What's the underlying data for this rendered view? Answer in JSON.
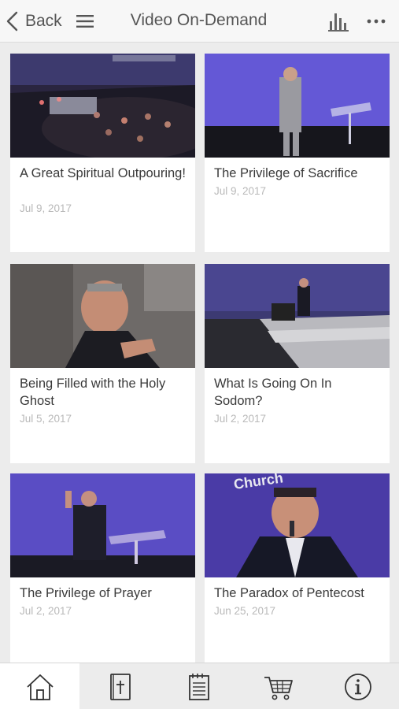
{
  "header": {
    "back_label": "Back",
    "title": "Video On-Demand",
    "icons": [
      "chevron-left-icon",
      "hamburger-menu-icon",
      "bar-chart-icon",
      "ellipsis-icon"
    ]
  },
  "videos": [
    {
      "title": "A Great Spiritual Outpouring!",
      "date": "Jul 9, 2017"
    },
    {
      "title": "The Privilege of Sacrifice",
      "date": "Jul 9, 2017"
    },
    {
      "title": "Being Filled with the Holy Ghost",
      "date": "Jul 5, 2017"
    },
    {
      "title": "What Is Going On In Sodom?",
      "date": "Jul 2, 2017"
    },
    {
      "title": "The Privilege of Prayer",
      "date": "Jul 2, 2017"
    },
    {
      "title": "The Paradox of Pentecost",
      "date": "Jun 25, 2017",
      "banner_text": "Church"
    }
  ],
  "tabbar": {
    "active": "home",
    "tabs": [
      "home-icon",
      "bible-icon",
      "notes-icon",
      "cart-icon",
      "info-icon"
    ]
  }
}
